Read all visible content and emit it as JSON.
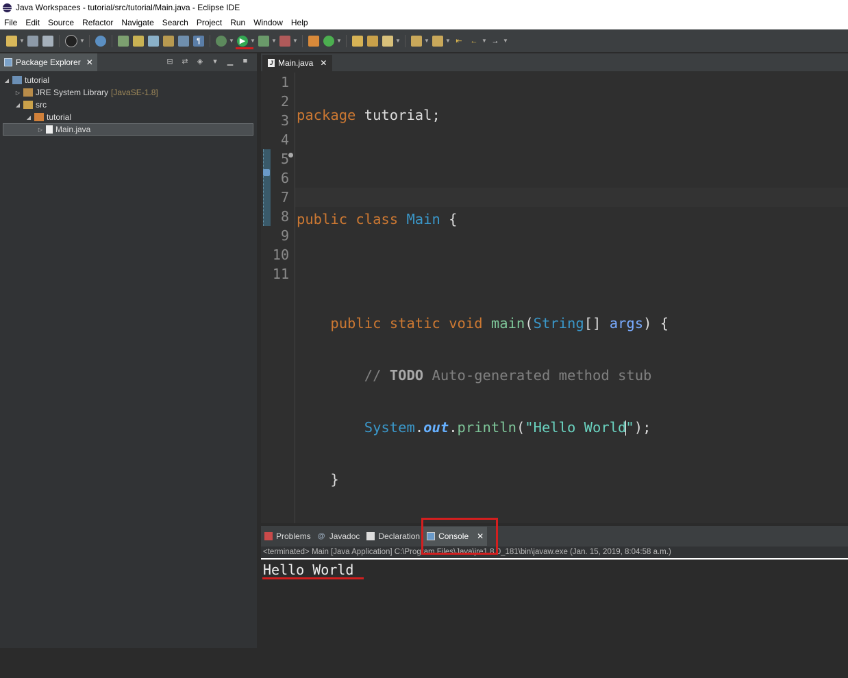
{
  "window": {
    "title": "Java Workspaces - tutorial/src/tutorial/Main.java - Eclipse IDE"
  },
  "menu": [
    "File",
    "Edit",
    "Source",
    "Refactor",
    "Navigate",
    "Search",
    "Project",
    "Run",
    "Window",
    "Help"
  ],
  "package_explorer": {
    "tab_label": "Package Explorer",
    "tree": [
      {
        "label": "tutorial",
        "decoration": ""
      },
      {
        "label": "JRE System Library",
        "decoration": "[JavaSE-1.8]"
      },
      {
        "label": "src",
        "decoration": ""
      },
      {
        "label": "tutorial",
        "decoration": ""
      },
      {
        "label": "Main.java",
        "decoration": ""
      }
    ]
  },
  "editor": {
    "tab_label": "Main.java",
    "line_numbers": [
      "1",
      "2",
      "3",
      "4",
      "5",
      "6",
      "7",
      "8",
      "9",
      "10",
      "11"
    ],
    "code": {
      "l1_kw": "package",
      "l1_rest": " tutorial;",
      "l3_kw1": "public",
      "l3_kw2": "class",
      "l3_cls": "Main",
      "l3_rest": " {",
      "l5_kw1": "public",
      "l5_kw2": "static",
      "l5_kw3": "void",
      "l5_fn": "main",
      "l5_type": "String",
      "l5_arg": "args",
      "l5_rest": ") {",
      "l6_cm": "// ",
      "l6_todo": "TODO",
      "l6_rest": " Auto-generated method stub",
      "l7_cls": "System",
      "l7_field": "out",
      "l7_fn": "println",
      "l7_str_a": "\"Hello World",
      "l7_str_b": "\"",
      "l7_rest": ");",
      "l8": "    }",
      "l10": "}"
    }
  },
  "bottom": {
    "tabs": [
      {
        "label": "Problems"
      },
      {
        "label": "Javadoc"
      },
      {
        "label": "Declaration"
      },
      {
        "label": "Console"
      }
    ],
    "console_status": "<terminated> Main [Java Application] C:\\Program Files\\Java\\jre1.8.0_181\\bin\\javaw.exe (Jan. 15, 2019, 8:04:58 a.m.)",
    "console_output": "Hello World"
  }
}
